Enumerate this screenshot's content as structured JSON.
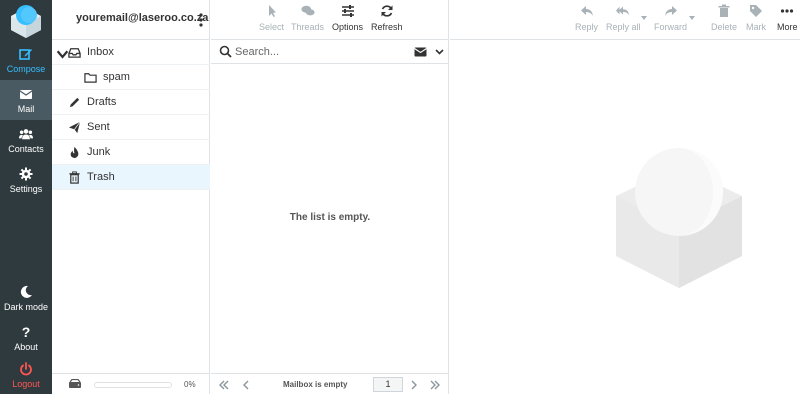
{
  "rail": {
    "compose": "Compose",
    "mail": "Mail",
    "contacts": "Contacts",
    "settings": "Settings",
    "dark_mode": "Dark mode",
    "about": "About",
    "logout": "Logout"
  },
  "account": {
    "email": "youremail@laseroo.co.za"
  },
  "folders": [
    {
      "label": "Inbox",
      "icon": "inbox-icon"
    },
    {
      "label": "spam",
      "icon": "folder-icon"
    },
    {
      "label": "Drafts",
      "icon": "pencil-icon"
    },
    {
      "label": "Sent",
      "icon": "paper-plane-icon"
    },
    {
      "label": "Junk",
      "icon": "fire-icon"
    },
    {
      "label": "Trash",
      "icon": "trash-icon"
    }
  ],
  "quota": {
    "percent_text": "0%",
    "used_fraction": 0
  },
  "list_toolbar": {
    "select": "Select",
    "threads": "Threads",
    "options": "Options",
    "refresh": "Refresh"
  },
  "search": {
    "placeholder": "Search..."
  },
  "list": {
    "empty_message": "The list is empty."
  },
  "list_footer": {
    "status": "Mailbox is empty",
    "page": "1"
  },
  "pane_toolbar": {
    "reply": "Reply",
    "reply_all": "Reply all",
    "forward": "Forward",
    "delete": "Delete",
    "mark": "Mark",
    "more": "More"
  },
  "colors": {
    "rail_bg": "#2f3a3f",
    "accent": "#37beff",
    "logout": "#ff5552",
    "selected_folder": "#e9f6fd"
  }
}
